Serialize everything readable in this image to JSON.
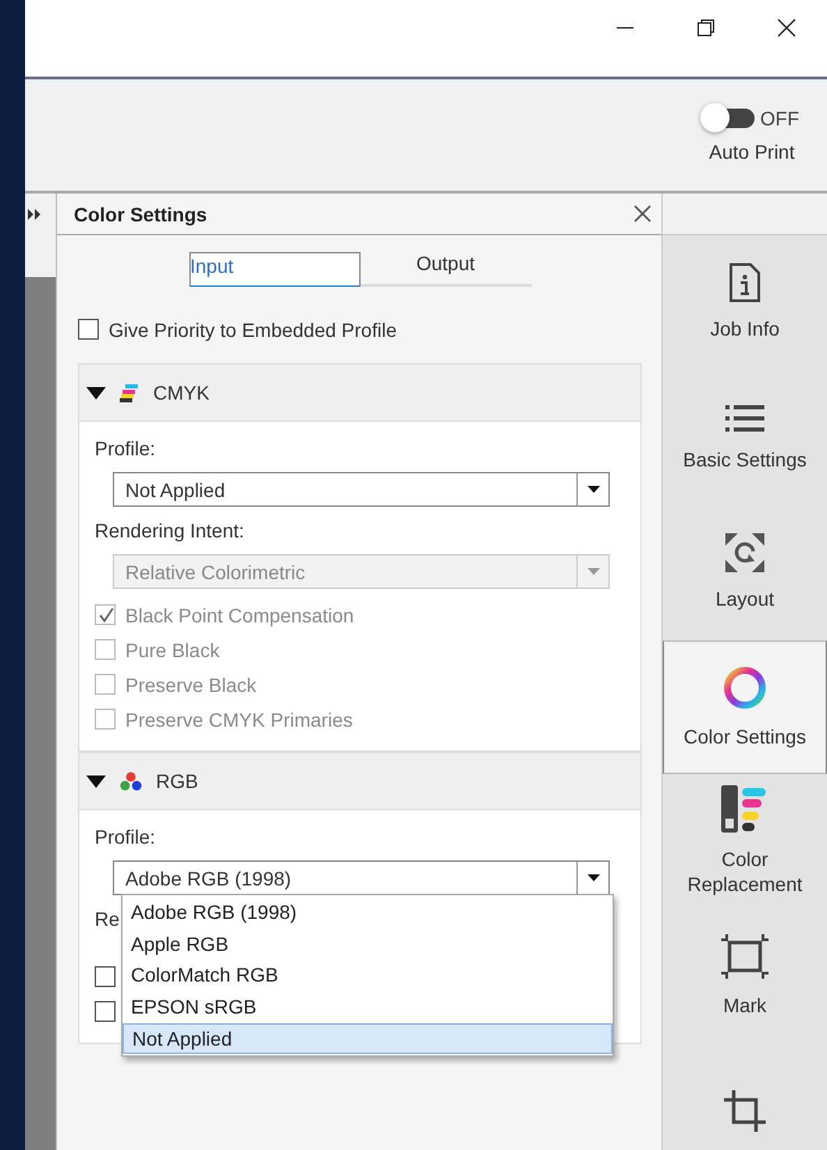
{
  "toolbar": {
    "auto_print": {
      "on": false,
      "state_label": "OFF",
      "label": "Auto Print"
    }
  },
  "panel": {
    "title": "Color Settings",
    "tabs": [
      {
        "label": "Input",
        "selected": true
      },
      {
        "label": "Output",
        "selected": false
      }
    ],
    "embedded_profile": {
      "label": "Give Priority to Embedded Profile",
      "checked": false
    },
    "sections": [
      {
        "kind": "cmyk",
        "title": "CMYK",
        "expanded": true,
        "profile_label": "Profile:",
        "profile": {
          "value": "Not Applied",
          "disabled": false
        },
        "intent_label": "Rendering Intent:",
        "intent": {
          "value": "Relative Colorimetric",
          "disabled": true
        },
        "options": [
          {
            "label": "Black Point Compensation",
            "checked": true,
            "disabled": true
          },
          {
            "label": "Pure Black",
            "checked": false,
            "disabled": true
          },
          {
            "label": "Preserve Black",
            "checked": false,
            "disabled": true
          },
          {
            "label": "Preserve CMYK Primaries",
            "checked": false,
            "disabled": true
          }
        ]
      },
      {
        "kind": "rgb",
        "title": "RGB",
        "expanded": true,
        "profile_label": "Profile:",
        "profile": {
          "value": "Adobe RGB (1998)",
          "disabled": false,
          "open": true,
          "menu": [
            {
              "label": "Adobe RGB (1998)",
              "highlighted": false
            },
            {
              "label": "Apple RGB",
              "highlighted": false
            },
            {
              "label": "ColorMatch RGB",
              "highlighted": false
            },
            {
              "label": "EPSON  sRGB",
              "highlighted": false
            },
            {
              "label": "Not Applied",
              "highlighted": true
            }
          ]
        },
        "intent_label": "Re",
        "options": [
          {
            "checked": false,
            "disabled": false
          },
          {
            "checked": false,
            "disabled": false
          }
        ]
      }
    ]
  },
  "sidebar": {
    "items": [
      {
        "kind": "info",
        "label": "Job Info",
        "selected": false
      },
      {
        "kind": "list",
        "label": "Basic Settings",
        "selected": false
      },
      {
        "kind": "layout",
        "label": "Layout",
        "selected": false
      },
      {
        "kind": "color",
        "label": "Color Settings",
        "selected": true
      },
      {
        "kind": "replace",
        "label": "Color Replacement",
        "selected": false
      },
      {
        "kind": "mark",
        "label": "Mark",
        "selected": false
      },
      {
        "kind": "crop",
        "selected": false
      }
    ]
  }
}
